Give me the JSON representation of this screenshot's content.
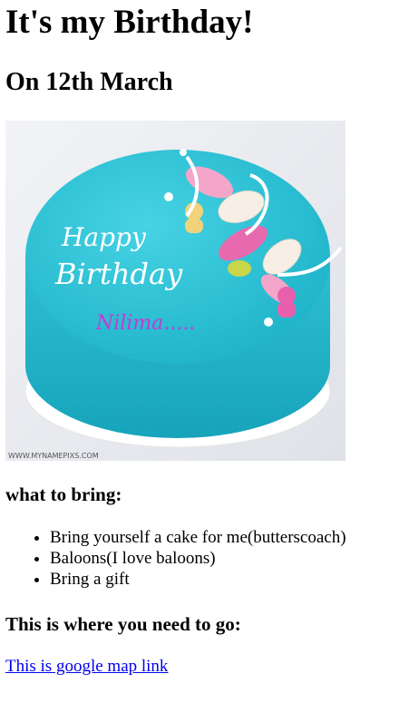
{
  "page": {
    "title": "It's my Birthday!",
    "subtitle": "On 12th March"
  },
  "image": {
    "alt": "Birthday cake",
    "cake_text_line1": "Happy",
    "cake_text_line2": "Birthday",
    "cake_name": "Nilima.....",
    "watermark": "WWW.MYNAMEPIXS.COM",
    "cake_color": "#33c3d6",
    "name_color": "#c43bd6"
  },
  "bring": {
    "heading": "what to bring:",
    "items": [
      "Bring yourself a cake for me(butterscoach)",
      "Baloons(I love baloons)",
      "Bring a gift"
    ]
  },
  "location": {
    "heading": "This is where you need to go:",
    "link_text": "This is google map link",
    "link_color": "#0000ee"
  }
}
